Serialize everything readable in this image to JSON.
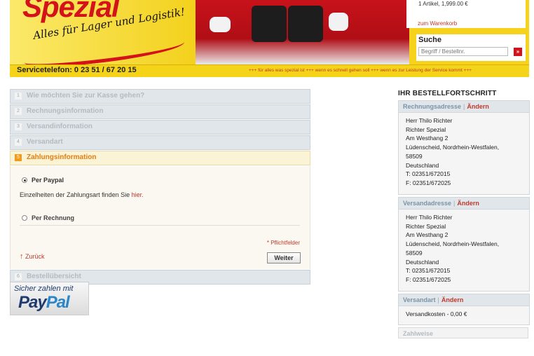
{
  "header": {
    "brand": "Spezial",
    "tagline": "Alles für Lager und Logistik!",
    "cart_summary": "1 Artikel, 1,999.00 €",
    "cart_link": "zum Warenkorb",
    "search_title": "Suche",
    "search_placeholder": "Begriff / Bestellnr.",
    "search_button": "»",
    "service_phone": "Servicetelefon: 0 23 51 / 67 20 15",
    "ticker": "+++ für alles was spezial ist +++ wenn es schnell gehen soll +++ wenn es zur Leistung der Service kommt +++"
  },
  "steps": [
    {
      "num": "1",
      "label": "Wie möchten Sie zur Kasse gehen?"
    },
    {
      "num": "2",
      "label": "Rechnungsinformation"
    },
    {
      "num": "3",
      "label": "Versandinformation"
    },
    {
      "num": "4",
      "label": "Versandart"
    },
    {
      "num": "5",
      "label": "Zahlungsinformation"
    },
    {
      "num": "6",
      "label": "Bestellübersicht"
    }
  ],
  "payment": {
    "option_paypal": "Per Paypal",
    "paypal_info": "Einzelheiten der Zahlungsart finden Sie",
    "paypal_link": "hier.",
    "option_rechnung": "Per Rechnung",
    "required_note": "* Pflichtfelder",
    "back": "Zurück",
    "next": "Weiter"
  },
  "paypal_badge": {
    "top": "Sicher zahlen mit",
    "logo_pay": "Pay",
    "logo_pal": "Pal"
  },
  "sidebar": {
    "title": "IHR BESTELLFORTSCHRITT",
    "change": "Ändern",
    "sep": "|",
    "billing_title": "Rechnungsadresse",
    "shipping_title": "Versandadresse",
    "address": {
      "name": "Herr Thilo Richter",
      "company": "Richter Spezial",
      "street": "Am Westhang 2",
      "city": "Lüdenscheid, Nordrhein-Westfalen,",
      "zip": "58509",
      "country": "Deutschland",
      "tel": "T: 02351/672015",
      "fax": "F: 02351/672025"
    },
    "shipping_method_title": "Versandart",
    "shipping_cost": "Versandkosten - 0,00 €",
    "payment_title": "Zahlweise"
  },
  "colors": {
    "accent_red": "#d4121a",
    "active_step": "#e47d10",
    "banner_yellow": "#f4d318"
  }
}
